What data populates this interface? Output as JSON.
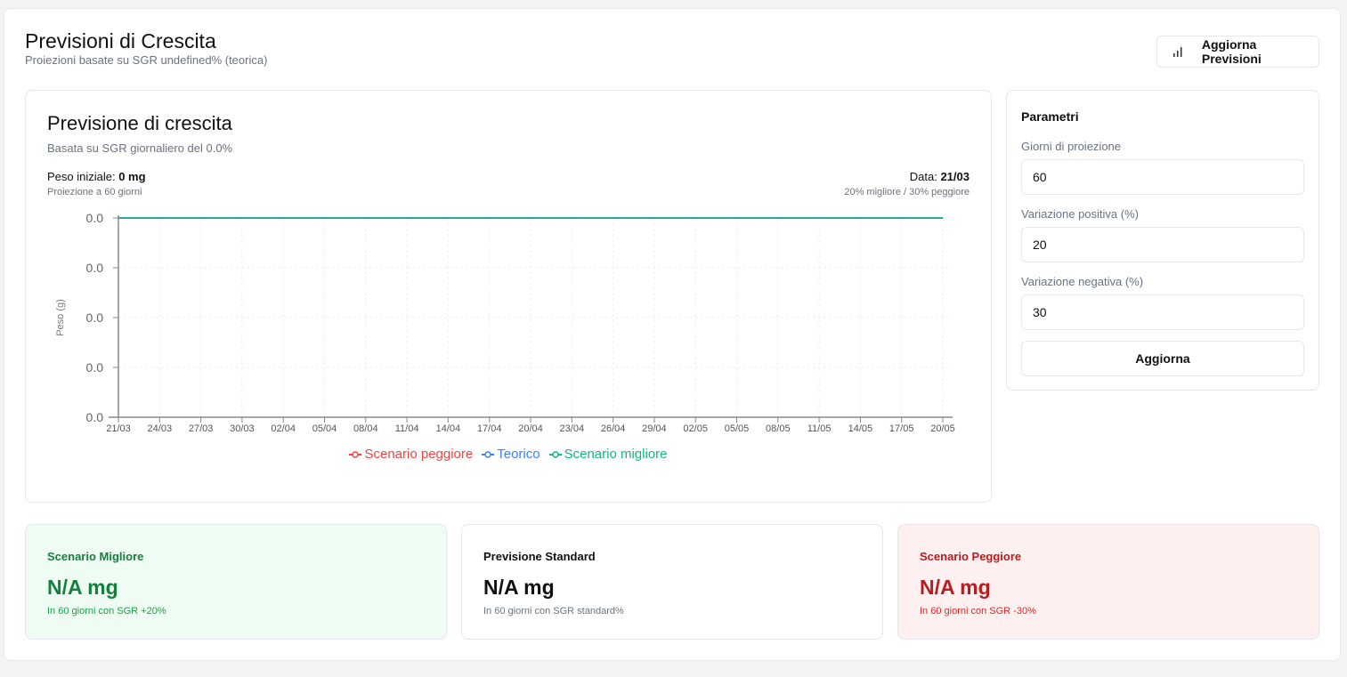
{
  "header": {
    "title": "Previsioni di Crescita",
    "subtitle": "Proiezioni basate su SGR undefined% (teorica)",
    "refresh_label": "Aggiorna Previsioni",
    "refresh_icon": "bar-chart-icon"
  },
  "chart_card": {
    "title": "Previsione di crescita",
    "subtitle": "Basata su SGR giornaliero del 0.0%",
    "initial_weight_label": "Peso iniziale: ",
    "initial_weight_value": "0 mg",
    "projection_note": "Proiezione a 60 giorni",
    "date_label": "Data: ",
    "date_value": "21/03",
    "variation_note": "20% migliore / 30% peggiore"
  },
  "chart_data": {
    "type": "line",
    "ylabel": "Peso (g)",
    "yticks": [
      "0.0",
      "0.0",
      "0.0",
      "0.0",
      "0.0"
    ],
    "categories": [
      "21/03",
      "24/03",
      "27/03",
      "30/03",
      "02/04",
      "05/04",
      "08/04",
      "11/04",
      "14/04",
      "17/04",
      "20/04",
      "23/04",
      "26/04",
      "29/04",
      "02/05",
      "05/05",
      "08/05",
      "11/05",
      "14/05",
      "17/05",
      "20/05"
    ],
    "series": [
      {
        "name": "Scenario peggiore",
        "color": "#ef4444",
        "values": [
          0,
          0,
          0,
          0,
          0,
          0,
          0,
          0,
          0,
          0,
          0,
          0,
          0,
          0,
          0,
          0,
          0,
          0,
          0,
          0,
          0
        ]
      },
      {
        "name": "Teorico",
        "color": "#3b82f6",
        "values": [
          0,
          0,
          0,
          0,
          0,
          0,
          0,
          0,
          0,
          0,
          0,
          0,
          0,
          0,
          0,
          0,
          0,
          0,
          0,
          0,
          0
        ]
      },
      {
        "name": "Scenario migliore",
        "color": "#10b981",
        "values": [
          0,
          0,
          0,
          0,
          0,
          0,
          0,
          0,
          0,
          0,
          0,
          0,
          0,
          0,
          0,
          0,
          0,
          0,
          0,
          0,
          0
        ]
      }
    ],
    "grid": true,
    "legend": "bottom"
  },
  "params": {
    "title": "Parametri",
    "days_label": "Giorni di proiezione",
    "days_value": "60",
    "pos_label": "Variazione positiva (%)",
    "pos_value": "20",
    "neg_label": "Variazione negativa (%)",
    "neg_value": "30",
    "update_label": "Aggiorna"
  },
  "summary": [
    {
      "title": "Scenario Migliore",
      "value": "N/A mg",
      "note": "In 60 giorni con SGR +20%"
    },
    {
      "title": "Previsione Standard",
      "value": "N/A mg",
      "note": "In 60 giorni con SGR standard%"
    },
    {
      "title": "Scenario Peggiore",
      "value": "N/A mg",
      "note": "In 60 giorni con SGR -30%"
    }
  ]
}
